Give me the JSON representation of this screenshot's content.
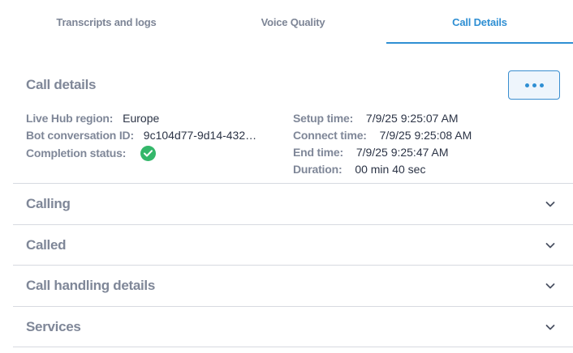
{
  "tabs": [
    {
      "label": "Transcripts and logs",
      "active": false
    },
    {
      "label": "Voice Quality",
      "active": false
    },
    {
      "label": "Call Details",
      "active": true
    }
  ],
  "call_details": {
    "title": "Call details",
    "more_button_icon": "more-horizontal-icon",
    "left_fields": [
      {
        "label": "Live Hub region:",
        "value": "Europe"
      },
      {
        "label": "Bot conversation ID:",
        "value": "9c104d77-9d14-432…"
      },
      {
        "label": "Completion status:",
        "value_icon": "success-check-icon",
        "value_color": "#34b76a"
      }
    ],
    "right_fields": [
      {
        "label": "Setup time:",
        "value": "7/9/25 9:25:07 AM"
      },
      {
        "label": "Connect time:",
        "value": "7/9/25 9:25:08 AM"
      },
      {
        "label": "End time:",
        "value": "7/9/25 9:25:47 AM"
      },
      {
        "label": "Duration:",
        "value": "00 min 40 sec"
      }
    ]
  },
  "accordion": [
    {
      "label": "Calling",
      "expanded": false
    },
    {
      "label": "Called",
      "expanded": false
    },
    {
      "label": "Call handling details",
      "expanded": false
    },
    {
      "label": "Services",
      "expanded": false
    }
  ],
  "colors": {
    "accent": "#2f8fd3",
    "success": "#34b76a",
    "label_gray": "#7f8798"
  }
}
